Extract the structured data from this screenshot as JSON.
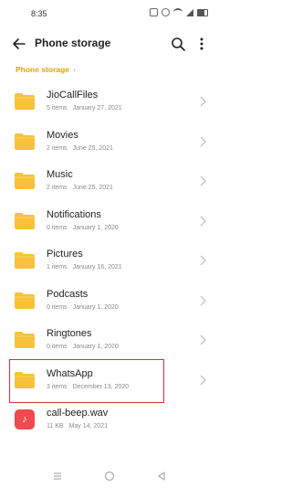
{
  "status": {
    "time": "8:35"
  },
  "header": {
    "title": "Phone storage"
  },
  "breadcrumb": {
    "label": "Phone storage"
  },
  "items": [
    {
      "name": "JioCallFiles",
      "count": "5 items",
      "date": "January 27, 2021"
    },
    {
      "name": "Movies",
      "count": "2 items",
      "date": "June 25, 2021"
    },
    {
      "name": "Music",
      "count": "2 items",
      "date": "June 25, 2021"
    },
    {
      "name": "Notifications",
      "count": "0 items",
      "date": "January 1, 2020"
    },
    {
      "name": "Pictures",
      "count": "1 items",
      "date": "January 16, 2021"
    },
    {
      "name": "Podcasts",
      "count": "0 items",
      "date": "January 1, 2020"
    },
    {
      "name": "Ringtones",
      "count": "0 items",
      "date": "January 1, 2020"
    },
    {
      "name": "WhatsApp",
      "count": "3 items",
      "date": "December 13, 2020"
    },
    {
      "name": "call-beep.wav",
      "count": "11 KB",
      "date": "May 14, 2021"
    }
  ],
  "colors": {
    "folder": "#f7c23a",
    "accent": "#e6a400",
    "highlight": "#d6313a",
    "audio": "#ef4a4e"
  }
}
